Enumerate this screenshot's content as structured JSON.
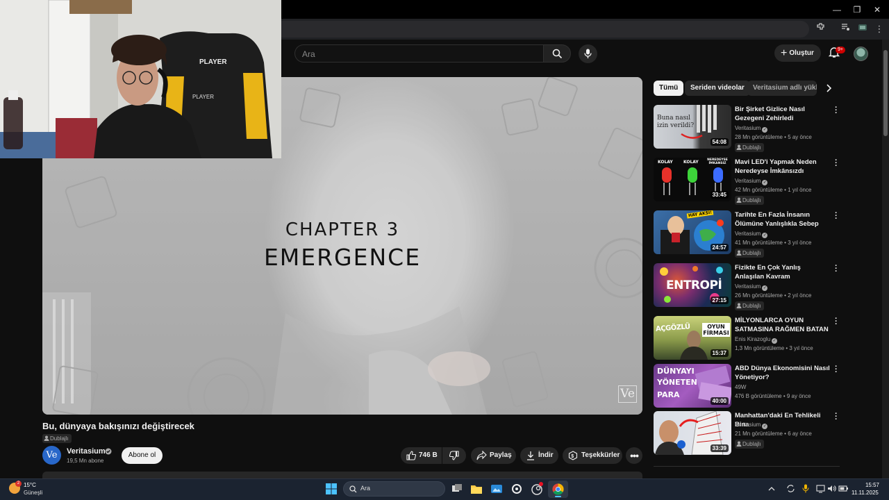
{
  "youtube": {
    "search": {
      "placeholder": "Ara"
    },
    "create_label": "Oluştur",
    "notifications_badge": "9+"
  },
  "player": {
    "chapter_title": "CHAPTER 3",
    "chapter_name": "EMERGENCE",
    "watermark": "Ve"
  },
  "video": {
    "title": "Bu, dünyaya bakışınızı değiştirecek",
    "dub_label": "Dublajlı",
    "channel": {
      "avatar_text": "Ve",
      "name": "Veritasium",
      "subscribers": "19,5 Mn abone"
    },
    "subscribe_label": "Abone ol",
    "actions": {
      "likes": "746 B",
      "share": "Paylaş",
      "download": "İndir",
      "thanks": "Teşekkürler",
      "more": "•••"
    }
  },
  "sidebar": {
    "chips": [
      "Tümü",
      "Seriden videolar",
      "Veritasium adlı yükleyiciden"
    ],
    "items": [
      {
        "title": "Bir Şirket Gizlice Nasıl Gezegeni Zehirledi",
        "channel": "Veritasium",
        "verified": true,
        "views": "28 Mn görüntüleme",
        "age": "5 ay önce",
        "duration": "54:08",
        "dub": "Dublajlı",
        "thumb_text": "Buna nasıl izin verildi?"
      },
      {
        "title": "Mavi LED'i Yapmak Neden Neredeyse İmkânsızdı",
        "channel": "Veritasium",
        "verified": true,
        "views": "42 Mn görüntüleme",
        "age": "1 yıl önce",
        "duration": "33:45",
        "dub": "Dublajlı",
        "thumb_labels": [
          "KOLAY",
          "KOLAY",
          "NEREDEYSE İMKANSIZ"
        ]
      },
      {
        "title": "Tarihte En Fazla İnsanın Ölümüne Yanlışlıkla Sebep Ola...",
        "channel": "Veritasium",
        "verified": true,
        "views": "41 Mn görüntüleme",
        "age": "3 yıl önce",
        "duration": "24:57",
        "dub": "Dublajlı",
        "thumb_text": "HAY AKSİ!"
      },
      {
        "title": "Fizikte En Çok Yanlış Anlaşılan Kavram",
        "channel": "Veritasium",
        "verified": true,
        "views": "26 Mn görüntüleme",
        "age": "2 yıl önce",
        "duration": "27:15",
        "dub": "Dublajlı",
        "thumb_text": "ENTROPİ"
      },
      {
        "title": "MİLYONLARCA OYUN SATMASINA RAĞMEN BATAN ...",
        "channel": "Enis Kirazoglu",
        "verified": true,
        "views": "1,3 Mn görüntüleme",
        "age": "3 yıl önce",
        "duration": "15:37",
        "dub": "",
        "thumb_labels": [
          "AÇGÖZLÜ",
          "OYUN FİRMASI"
        ]
      },
      {
        "title": "ABD Dünya Ekonomisini Nasıl Yönetiyor?",
        "channel": "49W",
        "verified": false,
        "views": "476 B görüntüleme",
        "age": "9 ay önce",
        "duration": "40:00",
        "dub": "",
        "thumb_labels": [
          "DÜNYAYI",
          "YÖNETEN",
          "PARA"
        ]
      },
      {
        "title": "Manhattan'daki En Tehlikeli Bina",
        "channel": "Veritasium",
        "verified": true,
        "views": "21 Mn görüntüleme",
        "age": "6 ay önce",
        "duration": "33:39",
        "dub": "Dublajlı"
      }
    ]
  },
  "taskbar": {
    "weather": {
      "temp": "15°C",
      "desc": "Güneşli",
      "badge": "2"
    },
    "search_label": "Ara",
    "time": "15:57",
    "date": "11.11.2025"
  },
  "colors": {
    "youtube_red": "#ff0000",
    "bg": "#0f0f0f",
    "chip_active": "#f1f1f1"
  }
}
